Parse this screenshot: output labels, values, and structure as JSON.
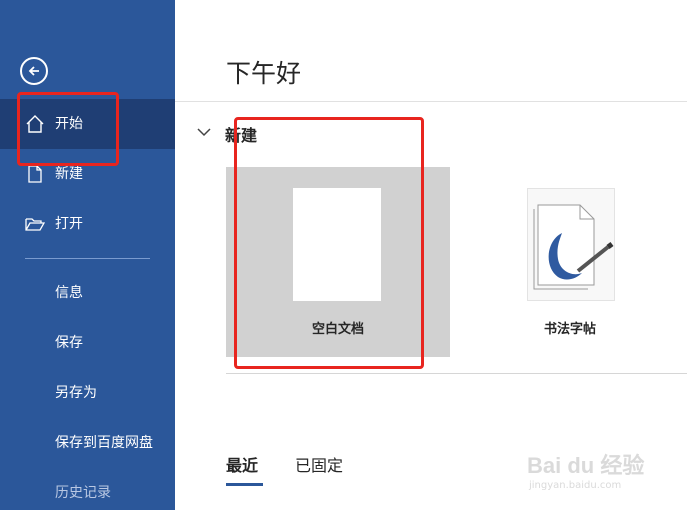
{
  "sidebar": {
    "items": [
      {
        "label": "开始",
        "icon": "home-icon"
      },
      {
        "label": "新建",
        "icon": "new-document-icon"
      },
      {
        "label": "打开",
        "icon": "folder-open-icon"
      }
    ],
    "sub_items": [
      "信息",
      "保存",
      "另存为",
      "保存到百度网盘",
      "历史记录"
    ]
  },
  "main": {
    "greeting": "下午好",
    "new_section": {
      "heading": "新建",
      "templates": [
        {
          "caption": "空白文档"
        },
        {
          "caption": "书法字帖"
        }
      ]
    },
    "tabs": [
      {
        "label": "最近",
        "active": true
      },
      {
        "label": "已固定",
        "active": false
      }
    ]
  },
  "colors": {
    "sidebar": "#2b579a",
    "sidebar_active": "#1f3e74",
    "highlight": "#e8251f"
  },
  "watermark": {
    "text": "Bai du 经验",
    "sub": "jingyan.baidu.com"
  }
}
